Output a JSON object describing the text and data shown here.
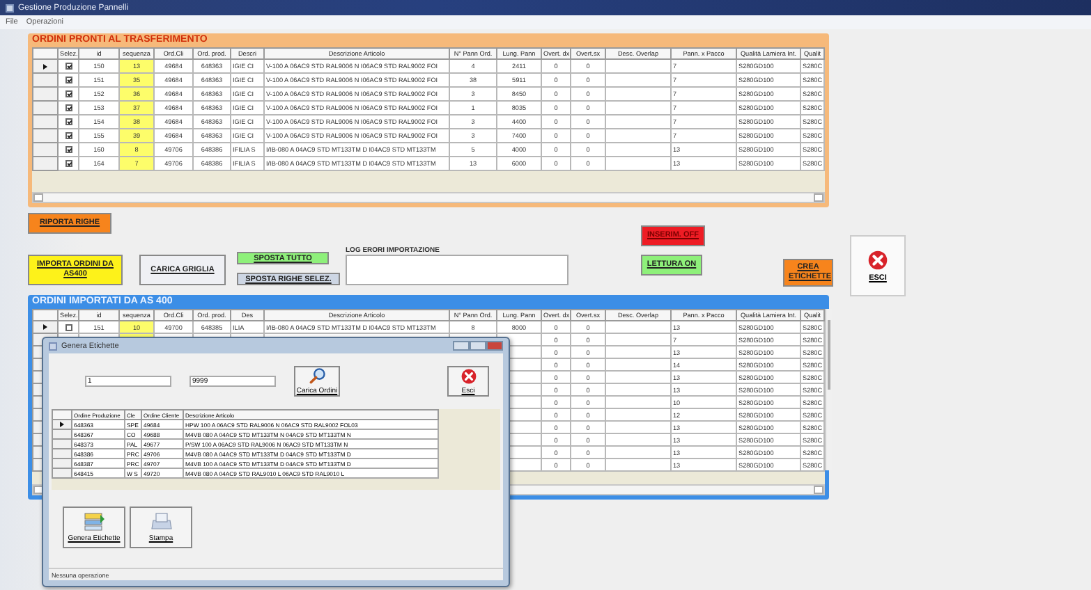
{
  "window": {
    "title": "Gestione Produzione Pannelli"
  },
  "menu": [
    "File",
    "Operazioni"
  ],
  "ready_panel": {
    "title": "ORDINI PRONTI AL TRASFERIMENTO",
    "check_column": "Selez.",
    "columns": [
      {
        "label": "id",
        "kind": "text"
      },
      {
        "label": "sequenza",
        "kind": "highlight"
      },
      {
        "label": "Ord.Cli",
        "kind": "text"
      },
      {
        "label": "Ord. prod.",
        "kind": "text"
      },
      {
        "label": "Descri",
        "kind": "left"
      },
      {
        "label": "Descrizione Articolo",
        "kind": "left"
      },
      {
        "label": "N° Pann Ord.",
        "kind": "text"
      },
      {
        "label": "Lung. Pann",
        "kind": "text"
      },
      {
        "label": "Overt. dx",
        "kind": "text"
      },
      {
        "label": "Overt.sx",
        "kind": "text"
      },
      {
        "label": "Desc. Overlap",
        "kind": "left"
      },
      {
        "label": "Pann. x Pacco",
        "kind": "left"
      },
      {
        "label": "Qualità Lamiera Int.",
        "kind": "left"
      },
      {
        "label": "Qualit",
        "kind": "left"
      }
    ],
    "rows": [
      {
        "current": true,
        "checked": true,
        "cells": [
          "150",
          "13",
          "49684",
          "648363",
          "IGIE CI",
          "V-100 A 06AC9 STD RAL9006 N I06AC9 STD RAL9002 FOI",
          "4",
          "2411",
          "0",
          "0",
          null,
          "7",
          "S280GD100",
          "S280C"
        ]
      },
      {
        "current": false,
        "checked": true,
        "cells": [
          "151",
          "35",
          "49684",
          "648363",
          "IGIE CI",
          "V-100 A 06AC9 STD RAL9006 N I06AC9 STD RAL9002 FOI",
          "38",
          "5911",
          "0",
          "0",
          null,
          "7",
          "S280GD100",
          "S280C"
        ]
      },
      {
        "current": false,
        "checked": true,
        "cells": [
          "152",
          "36",
          "49684",
          "648363",
          "IGIE CI",
          "V-100 A 06AC9 STD RAL9006 N I06AC9 STD RAL9002 FOI",
          "3",
          "8450",
          "0",
          "0",
          null,
          "7",
          "S280GD100",
          "S280C"
        ]
      },
      {
        "current": false,
        "checked": true,
        "cells": [
          "153",
          "37",
          "49684",
          "648363",
          "IGIE CI",
          "V-100 A 06AC9 STD RAL9006 N I06AC9 STD RAL9002 FOI",
          "1",
          "8035",
          "0",
          "0",
          null,
          "7",
          "S280GD100",
          "S280C"
        ]
      },
      {
        "current": false,
        "checked": true,
        "cells": [
          "154",
          "38",
          "49684",
          "648363",
          "IGIE CI",
          "V-100 A 06AC9 STD RAL9006 N I06AC9 STD RAL9002 FOI",
          "3",
          "4400",
          "0",
          "0",
          null,
          "7",
          "S280GD100",
          "S280C"
        ]
      },
      {
        "current": false,
        "checked": true,
        "cells": [
          "155",
          "39",
          "49684",
          "648363",
          "IGIE CI",
          "V-100 A 06AC9 STD RAL9006 N I06AC9 STD RAL9002 FOI",
          "3",
          "7400",
          "0",
          "0",
          null,
          "7",
          "S280GD100",
          "S280C"
        ]
      },
      {
        "current": false,
        "checked": true,
        "cells": [
          "160",
          "8",
          "49706",
          "648386",
          "IFILIA S",
          "I/IB-080  A 04AC9 STD MT133TM D I04AC9 STD MT133TM",
          "5",
          "4000",
          "0",
          "0",
          null,
          "13",
          "S280GD100",
          "S280C"
        ]
      },
      {
        "current": false,
        "checked": true,
        "cells": [
          "164",
          "7",
          "49706",
          "648386",
          "IFILIA S",
          "I/IB-080  A 04AC9 STD MT133TM D I04AC9 STD MT133TM",
          "13",
          "6000",
          "0",
          "0",
          null,
          "13",
          "S280GD100",
          "S280C"
        ]
      }
    ]
  },
  "buttons": [
    {
      "kind": "orange",
      "label": "RIPORTA RIGHE"
    },
    {
      "kind": "yellow",
      "label": "IMPORTA ORDINI DA AS400"
    },
    {
      "kind": "grey",
      "label": "CARICA GRIGLIA"
    },
    {
      "kind": "green",
      "label": "SPOSTA TUTTO"
    },
    {
      "kind": "steel",
      "label": "SPOSTA RIGHE SELEZ."
    },
    {
      "kind": "red",
      "label": "INSERIM. OFF"
    },
    {
      "kind": "green",
      "label": "LETTURA ON"
    },
    {
      "kind": "orange",
      "label": "CREA ETICHETTE"
    },
    {
      "kind": "exit",
      "label": "ESCI"
    }
  ],
  "log": {
    "label": "LOG ERORI IMPORTAZIONE"
  },
  "imported_panel": {
    "title": "ORDINI IMPORTATI DA AS 400",
    "check_column": "Selez.",
    "columns": [
      {
        "label": "id",
        "kind": "text"
      },
      {
        "label": "sequenza",
        "kind": "highlight"
      },
      {
        "label": "Ord.Cli",
        "kind": "text"
      },
      {
        "label": "Ord. prod.",
        "kind": "text"
      },
      {
        "label": "Des",
        "kind": "left"
      },
      {
        "label": "Descrizione Articolo",
        "kind": "left"
      },
      {
        "label": "N° Pann Ord.",
        "kind": "text"
      },
      {
        "label": "Lung. Pann",
        "kind": "text"
      },
      {
        "label": "Overt. dx",
        "kind": "text"
      },
      {
        "label": "Overt.sx",
        "kind": "text"
      },
      {
        "label": "Desc. Overlap",
        "kind": "left"
      },
      {
        "label": "Pann. x Pacco",
        "kind": "left"
      },
      {
        "label": "Qualità Lamiera Int.",
        "kind": "left"
      },
      {
        "label": "Qualit",
        "kind": "left"
      }
    ],
    "rows": [
      {
        "current": true,
        "checked": false,
        "cells": [
          "151",
          "10",
          "49700",
          "648385",
          "ILIA",
          "I/IB-080  A 04AC9 STD MT133TM D I04AC9 STD MT133TM",
          "8",
          "8000",
          "0",
          "0",
          null,
          "13",
          "S280GD100",
          "S280C"
        ]
      },
      {
        "cells": [
          null,
          null,
          null,
          null,
          null,
          null,
          null,
          null,
          "0",
          "0",
          null,
          "7",
          "S280GD100",
          "S280C"
        ]
      },
      {
        "cells": [
          null,
          null,
          null,
          null,
          null,
          null,
          null,
          null,
          "0",
          "0",
          null,
          "13",
          "S280GD100",
          "S280C"
        ]
      },
      {
        "cells": [
          null,
          null,
          null,
          null,
          null,
          null,
          null,
          null,
          "0",
          "0",
          null,
          "14",
          "S280GD100",
          "S280C"
        ]
      },
      {
        "cells": [
          null,
          null,
          null,
          null,
          null,
          null,
          null,
          null,
          "0",
          "0",
          null,
          "13",
          "S280GD100",
          "S280C"
        ]
      },
      {
        "cells": [
          null,
          null,
          null,
          null,
          null,
          null,
          null,
          null,
          "0",
          "0",
          null,
          "13",
          "S280GD100",
          "S280C"
        ]
      },
      {
        "cells": [
          null,
          null,
          null,
          null,
          null,
          null,
          null,
          null,
          "0",
          "0",
          null,
          "10",
          "S280GD100",
          "S280C"
        ]
      },
      {
        "cells": [
          null,
          null,
          null,
          null,
          null,
          null,
          null,
          null,
          "0",
          "0",
          null,
          "12",
          "S280GD100",
          "S280C"
        ]
      },
      {
        "cells": [
          null,
          null,
          null,
          null,
          null,
          null,
          null,
          null,
          "0",
          "0",
          null,
          "13",
          "S280GD100",
          "S280C"
        ]
      },
      {
        "cells": [
          null,
          null,
          null,
          null,
          null,
          null,
          null,
          null,
          "0",
          "0",
          null,
          "13",
          "S280GD100",
          "S280C"
        ]
      },
      {
        "cells": [
          null,
          null,
          null,
          null,
          null,
          null,
          null,
          null,
          "0",
          "0",
          null,
          "13",
          "S280GD100",
          "S280C"
        ]
      },
      {
        "cells": [
          null,
          null,
          null,
          null,
          null,
          null,
          null,
          null,
          "0",
          "0",
          null,
          "13",
          "S280GD100",
          "S280C"
        ]
      }
    ]
  },
  "dialog": {
    "title": "Genera Etichette",
    "from": "1",
    "to": "9999",
    "load_button": "Carica Ordini",
    "exit_button": "Esci",
    "columns": [
      "Ordine Produzione",
      "Cle",
      "Ordine Cliente",
      "Descrizione Articolo"
    ],
    "rows": [
      {
        "current": true,
        "cells": [
          "648363",
          "SPE",
          "49684",
          "HPW 100 A 06AC9 STD RAL9006  N  06AC9 STD RAL9002 FOL03"
        ]
      },
      {
        "current": false,
        "cells": [
          "648367",
          "CO",
          "49688",
          "M4VB 080   A 04AC9 STD MT133TM N  04AC9 STD MT133TM N"
        ]
      },
      {
        "current": false,
        "cells": [
          "648373",
          "PAL",
          "49677",
          "P/SW 100 A 06AC9 STD RAL9006  N  06AC9 STD MT133TM  N"
        ]
      },
      {
        "current": false,
        "cells": [
          "648386",
          "PRC",
          "49706",
          "M4VB 080   A 04AC9 STD MT133TM D  04AC9 STD MT133TM D"
        ]
      },
      {
        "current": false,
        "cells": [
          "648387",
          "PRC",
          "49707",
          "M4VB 100   A 04AC9 STD MT133TM D  04AC9 STD MT133TM D"
        ]
      },
      {
        "current": false,
        "cells": [
          "648415",
          "W S",
          "49720",
          "M4VB 080   A 04AC9 STD RAL9010 L  06AC9 STD RAL9010 L"
        ]
      }
    ],
    "actions": [
      "Genera Etichette",
      "Stampa"
    ],
    "status": "Nessuna operazione"
  }
}
